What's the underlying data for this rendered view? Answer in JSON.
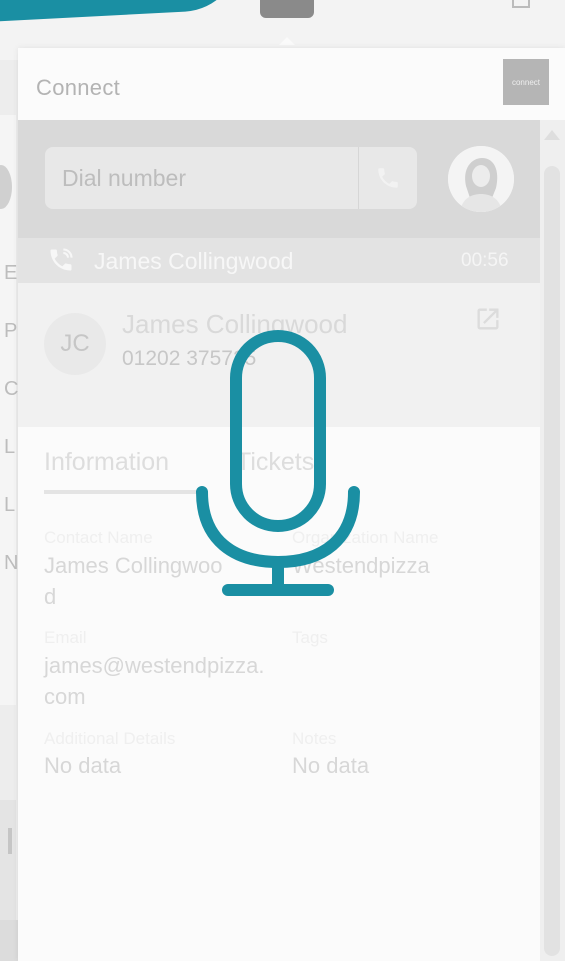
{
  "panel": {
    "title": "Connect",
    "brand_logo_text": "connect"
  },
  "dialer": {
    "placeholder": "Dial number",
    "call_button_icon": "phone-icon"
  },
  "active_call": {
    "name": "James Collingwood",
    "timer": "00:56",
    "icon": "phone-in-call-icon"
  },
  "contact": {
    "initials": "JC",
    "name": "James Collingwood",
    "phone": "01202 375725"
  },
  "tabs": [
    {
      "label": "Information",
      "active": true
    },
    {
      "label": "Tickets",
      "active": false
    }
  ],
  "fields": {
    "contact_name_label": "Contact Name",
    "contact_name_value": "James Collingwood",
    "organization_label": "Organization Name",
    "organization_value": "Westendpizza",
    "email_label": "Email",
    "email_value": "james@westendpizza.com",
    "tags_label": "Tags",
    "additional_label": "Additional Details",
    "additional_value": "No data",
    "notes_label": "Notes",
    "notes_value": "No data"
  },
  "background_letters": [
    "E",
    "P",
    "C",
    "L",
    "L",
    "N"
  ],
  "colors": {
    "accent": "#1a8fa3",
    "mic_overlay": "#1a8fa3"
  }
}
